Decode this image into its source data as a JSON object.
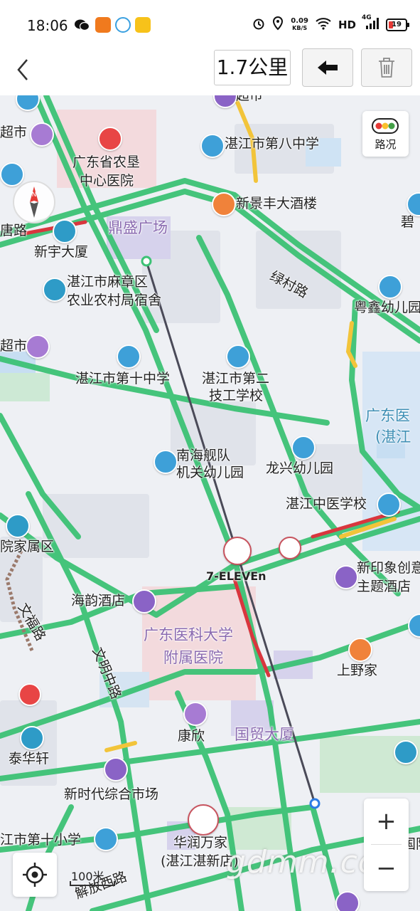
{
  "status_bar": {
    "time": "18:06",
    "net_speed": "0.09",
    "net_unit": "KB/S",
    "hd": "HD",
    "network": "4G",
    "battery": "19"
  },
  "toolbar": {
    "distance": "1.7公里"
  },
  "map": {
    "labels": {
      "chaoshi_top": "超市",
      "chaoshi_left": "超市",
      "chaoshi_left2": "超市",
      "hospital_line1": "广东省农垦",
      "hospital_line2": "中心医院",
      "school8": "湛江市第八中学",
      "restaurant": "新景丰大酒楼",
      "dingsheng": "鼎盛广场",
      "tang_road": "唐路",
      "xinyu": "新宇大厦",
      "dorm_line1": "湛江市麻章区",
      "dorm_line2": "农业农村局宿舍",
      "lvcun": "绿村路",
      "yuexin": "粤鑫幼儿园",
      "bi": "碧",
      "school10": "湛江市第十中学",
      "tech_line1": "湛江市第二",
      "tech_line2": "技工学校",
      "gdy_line1": "广东医",
      "gdy_line2": "(湛江",
      "navy_line1": "南海舰队",
      "navy_line2": "机关幼儿园",
      "longxing": "龙兴幼儿园",
      "tcm": "湛江中医学校",
      "family": "院家属区",
      "seven": "7-ELEVEn",
      "xinyinxiang_line1": "新印象创意",
      "xinyinxiang_line2": "主题酒店",
      "haiyun": "海韵酒店",
      "wenfu_road": "文福路",
      "wenming_road": "文明中路",
      "hospital2_line1": "广东医科大学",
      "hospital2_line2": "附属医院",
      "shangye": "上野家",
      "kangxin": "康欣",
      "guomao": "国贸大厦",
      "taihua": "泰华轩",
      "market": "新时代综合市场",
      "primary10": "江市第十小学",
      "runwan_line1": "华润万家",
      "runwan_line2": "(湛江湛新店)",
      "jiefang": "解放西路",
      "guoji": "国际"
    },
    "traffic_label": "路况",
    "scale_label": "100米",
    "zoom_in": "+",
    "zoom_out": "−",
    "watermark": "gdmm.com",
    "colors": {
      "road_smooth": "#3cc275",
      "road_slow": "#f2c43a",
      "road_congested": "#d9363e",
      "measure_line": "#4a4a58"
    }
  }
}
